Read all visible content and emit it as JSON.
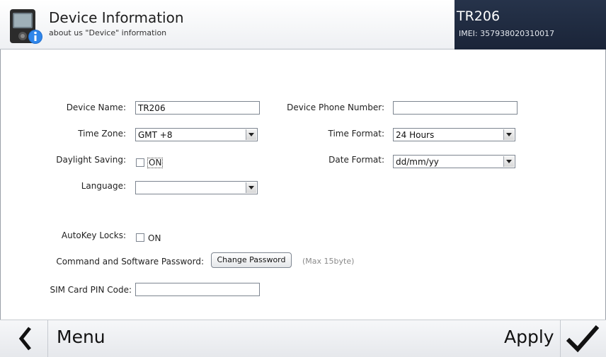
{
  "header": {
    "title": "Device Information",
    "subtitle": "about us \"Device\" information",
    "device_title": "TR206",
    "imei": "IMEI: 357938020310017",
    "icon": "device-info-icon"
  },
  "form": {
    "device_name_label": "Device Name:",
    "device_name_value": "TR206",
    "phone_label": "Device Phone Number:",
    "phone_value": "",
    "time_zone_label": "Time Zone:",
    "time_zone_value": "GMT +8",
    "time_format_label": "Time Format:",
    "time_format_value": "24 Hours",
    "dst_label": "Daylight Saving:",
    "dst_option": "ON",
    "date_format_label": "Date Format:",
    "date_format_value": "dd/mm/yy",
    "language_label": "Language:",
    "language_value": "",
    "autokey_label": "AutoKey Locks:",
    "autokey_option": "ON",
    "password_label": "Command and Software Password:",
    "change_password_button": "Change Password",
    "password_hint": "(Max 15byte)",
    "sim_pin_label": "SIM Card PIN Code:",
    "sim_pin_value": ""
  },
  "footer": {
    "back_icon": "chevron-left-icon",
    "menu_label": "Menu",
    "apply_label": "Apply",
    "apply_icon": "checkmark-icon"
  },
  "colors": {
    "header_dark": "#1f2a40",
    "border": "#7d8590"
  }
}
